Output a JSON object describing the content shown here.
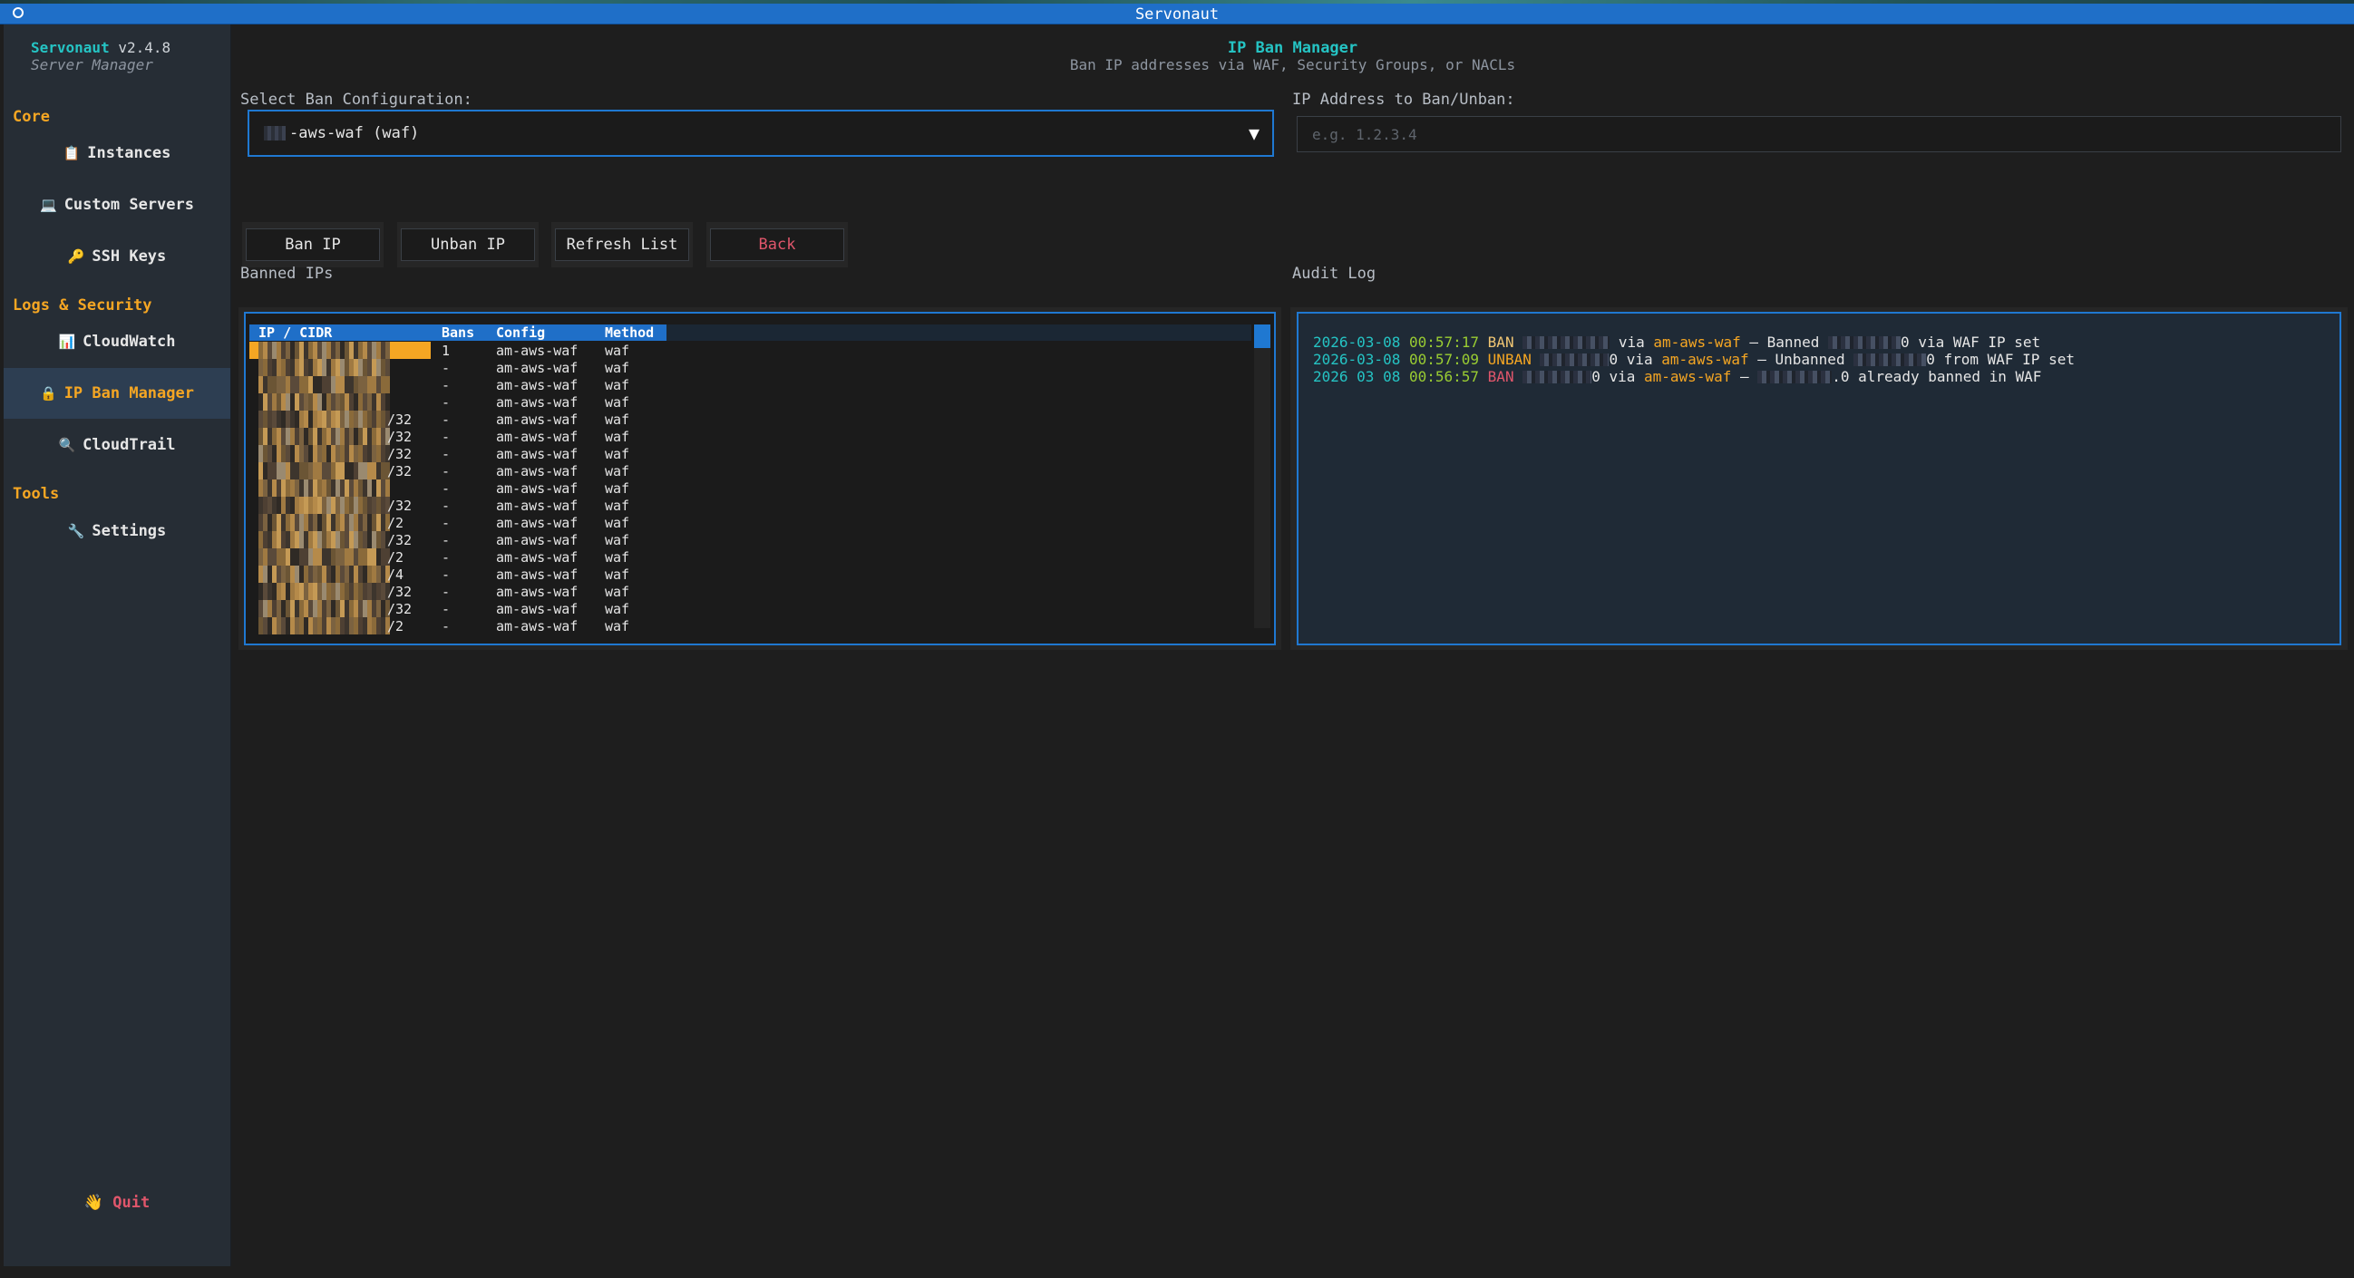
{
  "window": {
    "title": "Servonaut"
  },
  "sidebar": {
    "app_name": "Servonaut",
    "version": "v2.4.8",
    "subtitle": "Server Manager",
    "sections": [
      {
        "title": "Core",
        "items": [
          {
            "label": "Instances",
            "icon": "clipboard-icon",
            "glyph": "📋"
          },
          {
            "label": "Custom Servers",
            "icon": "laptop-icon",
            "glyph": "💻"
          },
          {
            "label": "SSH Keys",
            "icon": "key-icon",
            "glyph": "🔑"
          }
        ]
      },
      {
        "title": "Logs & Security",
        "items": [
          {
            "label": "CloudWatch",
            "icon": "chart-icon",
            "glyph": "📊"
          },
          {
            "label": "IP Ban Manager",
            "icon": "lock-icon",
            "glyph": "🔒",
            "active": true
          },
          {
            "label": "CloudTrail",
            "icon": "magnifier-icon",
            "glyph": "🔍"
          }
        ]
      },
      {
        "title": "Tools",
        "items": [
          {
            "label": "Settings",
            "icon": "wrench-icon",
            "glyph": "🔧"
          }
        ]
      }
    ],
    "quit": {
      "label": "Quit",
      "glyph": "👋"
    }
  },
  "header": {
    "title": "IP Ban Manager",
    "subtitle": "Ban IP addresses via WAF, Security Groups, or NACLs"
  },
  "form": {
    "config_label": "Select Ban Configuration:",
    "config_value": "-aws-waf (waf)",
    "ip_label": "IP Address to Ban/Unban:",
    "ip_placeholder": "e.g. 1.2.3.4",
    "ip_value": ""
  },
  "buttons": {
    "ban": "Ban IP",
    "unban": "Unban IP",
    "refresh": "Refresh List",
    "back": "Back"
  },
  "banned": {
    "title": "Banned IPs",
    "columns": [
      "IP / CIDR",
      "Bans",
      "Config",
      "Method"
    ],
    "rows": [
      {
        "ip_suffix": "",
        "bans": "1",
        "config": "am-aws-waf",
        "method": "waf"
      },
      {
        "ip_suffix": "",
        "bans": "-",
        "config": "am-aws-waf",
        "method": "waf"
      },
      {
        "ip_suffix": "",
        "bans": "-",
        "config": "am-aws-waf",
        "method": "waf"
      },
      {
        "ip_suffix": "",
        "bans": "-",
        "config": "am-aws-waf",
        "method": "waf"
      },
      {
        "ip_suffix": "/32",
        "bans": "-",
        "config": "am-aws-waf",
        "method": "waf"
      },
      {
        "ip_suffix": "/32",
        "bans": "-",
        "config": "am-aws-waf",
        "method": "waf"
      },
      {
        "ip_suffix": "/32",
        "bans": "-",
        "config": "am-aws-waf",
        "method": "waf"
      },
      {
        "ip_suffix": "/32",
        "bans": "-",
        "config": "am-aws-waf",
        "method": "waf"
      },
      {
        "ip_suffix": "",
        "bans": "-",
        "config": "am-aws-waf",
        "method": "waf"
      },
      {
        "ip_suffix": "/32",
        "bans": "-",
        "config": "am-aws-waf",
        "method": "waf"
      },
      {
        "ip_suffix": "/2",
        "bans": "-",
        "config": "am-aws-waf",
        "method": "waf"
      },
      {
        "ip_suffix": "/32",
        "bans": "-",
        "config": "am-aws-waf",
        "method": "waf"
      },
      {
        "ip_suffix": "/2",
        "bans": "-",
        "config": "am-aws-waf",
        "method": "waf"
      },
      {
        "ip_suffix": "/4",
        "bans": "-",
        "config": "am-aws-waf",
        "method": "waf"
      },
      {
        "ip_suffix": "/32",
        "bans": "-",
        "config": "am-aws-waf",
        "method": "waf"
      },
      {
        "ip_suffix": "/32",
        "bans": "-",
        "config": "am-aws-waf",
        "method": "waf"
      },
      {
        "ip_suffix": "/2",
        "bans": "-",
        "config": "am-aws-waf",
        "method": "waf"
      }
    ]
  },
  "audit": {
    "title": "Audit Log",
    "entries": [
      {
        "date": "2026-03-08",
        "time": "00:57:17",
        "action": "BAN",
        "via": " via ",
        "config": "am-aws-waf",
        "rest_a": " – Banned ",
        "ip_tail": "0",
        "rest_b": " via WAF IP set"
      },
      {
        "date": "2026-03-08",
        "time": "00:57:09",
        "action": "UNBAN",
        "via": "0 via ",
        "config": "am-aws-waf",
        "rest_a": " – Unbanned ",
        "ip_tail": "0",
        "rest_b": " from WAF IP set"
      },
      {
        "date": "2026 03 08",
        "time": "00:56:57",
        "action": "BAN",
        "via": "0 via ",
        "config": "am-aws-waf",
        "rest_a": " – ",
        "ip_tail": ".0",
        "rest_b": " already banned in WAF"
      }
    ]
  },
  "colors": {
    "accent": "#1f78d1",
    "orange": "#f5a623",
    "teal": "#25c4c4",
    "danger": "#e0566b"
  }
}
